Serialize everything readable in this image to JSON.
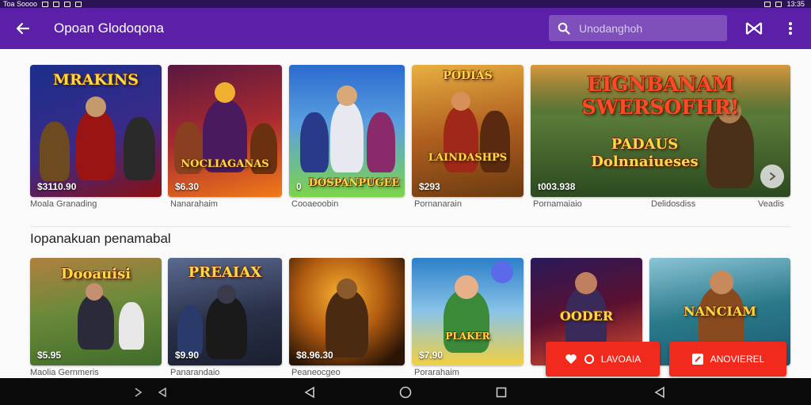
{
  "status_bar": {
    "left_text": "Toa Soooo",
    "time": "13:35"
  },
  "app_bar": {
    "title": "Opoan Glodoqona",
    "search": {
      "placeholder": "Unodanghoh"
    },
    "icons": [
      "back-arrow-icon",
      "search-icon",
      "bowtie-icon",
      "more-vert-icon"
    ]
  },
  "featured": {
    "cards": [
      {
        "art_title": "MRAKINS",
        "price": "$3110.90",
        "label": "Moala Granading",
        "colors": [
          "#1b2f8a",
          "#8a1010"
        ]
      },
      {
        "art_title": "NOCLIAGANAS",
        "price": "$6.30",
        "label": "Nanarahaim",
        "colors": [
          "#5a1840",
          "#f27a18"
        ]
      },
      {
        "art_title": "DOSPANPUGEE",
        "price": "0",
        "label": "Cooaeoobin",
        "colors": [
          "#2b6ad0",
          "#7dd44a"
        ]
      },
      {
        "art_title": "LAINDASHPS",
        "price": "$293",
        "label": "Pornanarain",
        "colors": [
          "#6b3a10",
          "#f0a020"
        ]
      },
      {
        "art_title": "EIGNBANAM SWERSOFHR!",
        "art_subtitle": "PADAUS Dolnnaiueses",
        "price": "t003.938",
        "label_left": "Pornamaiaio",
        "label_mid": "Delidosdiss",
        "label_right": "Veadis",
        "colors": [
          "#2b4a20",
          "#d8a030"
        ]
      }
    ]
  },
  "section": {
    "title": "Iopanakuan penamabal"
  },
  "second_row": {
    "cards": [
      {
        "art_title": "Dooauisi",
        "price": "$5.95",
        "label": "Maolia Gernmeris",
        "colors": [
          "#3f6b2a",
          "#9bd04a"
        ]
      },
      {
        "art_title": "PREAIAX",
        "price": "$9.90",
        "label": "Panarandaio",
        "colors": [
          "#1a2030",
          "#6a7390"
        ]
      },
      {
        "art_title": "",
        "price": "$8.96.30",
        "label": "Peaneocgeo",
        "colors": [
          "#2a1406",
          "#e08a12"
        ]
      },
      {
        "art_title": "PLAKER",
        "price": "$7.90",
        "label": "Porarahaim",
        "colors": [
          "#2c7fc9",
          "#f2d040"
        ]
      },
      {
        "art_title": "OODER",
        "price": "",
        "label": "",
        "colors": [
          "#5a1030",
          "#e05030"
        ]
      },
      {
        "art_title": "NANCIAM",
        "price": "",
        "label": "",
        "colors": [
          "#1a5a70",
          "#8bc4d6"
        ]
      }
    ]
  },
  "cta_buttons": [
    {
      "label": "LAVOAIA"
    },
    {
      "label": "ANOVIEREL"
    }
  ],
  "theme": {
    "primary": "#5b1fa8",
    "status": "#2c1358",
    "accent": "#f2291d"
  }
}
